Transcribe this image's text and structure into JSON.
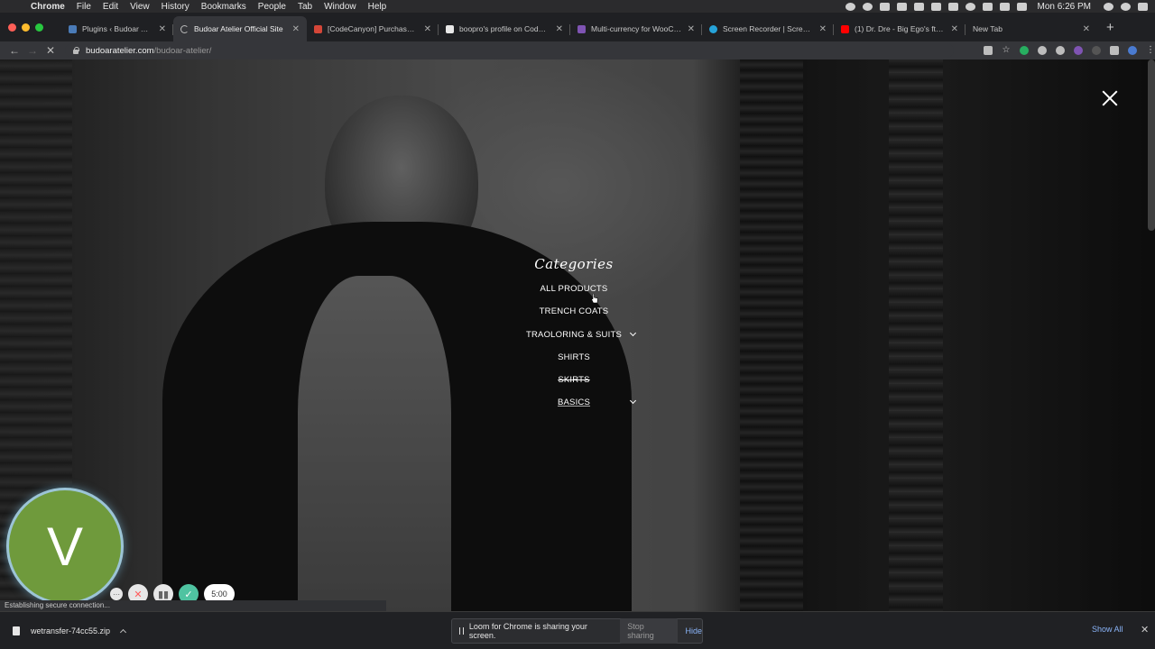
{
  "menubar": {
    "items": [
      "Chrome",
      "File",
      "Edit",
      "View",
      "History",
      "Bookmarks",
      "People",
      "Tab",
      "Window",
      "Help"
    ],
    "clock": "Mon 6:26 PM"
  },
  "tabs": [
    {
      "title": "Plugins ‹ Budoar Atelier — ",
      "favicon_color": "#4a7bb7"
    },
    {
      "title": "Budoar Atelier Official Site",
      "favicon_color": "#888888",
      "active": true
    },
    {
      "title": "[CodeCanyon] Purchase Co",
      "favicon_color": "#d44638"
    },
    {
      "title": "boopro's profile on CodeCa",
      "favicon_color": "#e8e8e8"
    },
    {
      "title": "Multi-currency for WooCom",
      "favicon_color": "#7f54b3"
    },
    {
      "title": "Screen Recorder | Screenc",
      "favicon_color": "#26a3d9"
    },
    {
      "title": "(1) Dr. Dre - Big Ego's ft. 2P",
      "favicon_color": "#ff0000"
    },
    {
      "title": "New Tab",
      "favicon_color": "#35363a"
    }
  ],
  "address": {
    "domain": "budoaratelier.com",
    "path": "/budoar-atelier/"
  },
  "menu": {
    "title": "Categories",
    "items": [
      {
        "label": "ALL PRODUCTS"
      },
      {
        "label": "TRENCH COATS"
      },
      {
        "label": "TRAOLORING & SUITS",
        "has_submenu": true
      },
      {
        "label": "SHIRTS"
      },
      {
        "label": "SKIRTS"
      },
      {
        "label": "BASICS",
        "has_submenu": true
      }
    ]
  },
  "loom": {
    "avatar_letter": "V",
    "timer": "5:00"
  },
  "status_text": "Establishing secure connection...",
  "download": {
    "filename": "wetransfer-74cc55.zip"
  },
  "share_bar": {
    "message": "Loom for Chrome is sharing your screen.",
    "stop_label": "Stop sharing",
    "hide_label": "Hide"
  },
  "shelf": {
    "show_all_label": "Show All"
  }
}
